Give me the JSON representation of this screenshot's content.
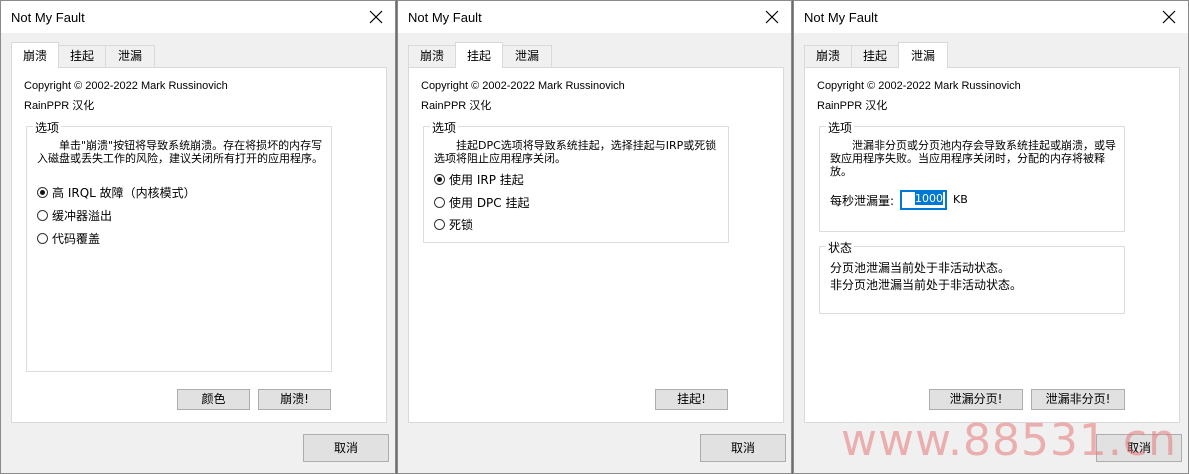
{
  "windows": [
    {
      "title": "Not My Fault",
      "tabs": [
        "崩溃",
        "挂起",
        "泄漏"
      ],
      "copyright": "Copyright © 2002-2022 Mark Russinovich",
      "credit": "RainPPR 汉化",
      "group_label": "选项",
      "description": "单击\"崩溃\"按钮将导致系统崩溃。存在将损坏的内存写入磁盘或丢失工作的风险，建议关闭所有打开的应用程序。",
      "options": [
        "高 IRQL 故障（内核模式）",
        "缓冲器溢出",
        "代码覆盖"
      ],
      "buttons": [
        "颜色",
        "崩溃!"
      ],
      "cancel": "取消"
    },
    {
      "title": "Not My Fault",
      "tabs": [
        "崩溃",
        "挂起",
        "泄漏"
      ],
      "copyright": "Copyright © 2002-2022 Mark Russinovich",
      "credit": "RainPPR 汉化",
      "group_label": "选项",
      "description": "挂起DPC选项将导致系统挂起，选择挂起与IRP或死锁选项将阻止应用程序关闭。",
      "options": [
        "使用 IRP 挂起",
        "使用 DPC 挂起",
        "死锁"
      ],
      "buttons": [
        "挂起!"
      ],
      "cancel": "取消"
    },
    {
      "title": "Not My Fault",
      "tabs": [
        "崩溃",
        "挂起",
        "泄漏"
      ],
      "copyright": "Copyright © 2002-2022 Mark Russinovich",
      "credit": "RainPPR 汉化",
      "group_label": "选项",
      "description": "泄漏非分页或分页池内存会导致系统挂起或崩溃，或导致应用程序失败。当应用程序关闭时，分配的内存将被释放。",
      "rate_label": "每秒泄漏量:",
      "rate_value": "1000",
      "rate_unit": "KB",
      "status_label": "状态",
      "status_lines": [
        "分页池泄漏当前处于非活动状态。",
        "非分页池泄漏当前处于非活动状态。"
      ],
      "buttons": [
        "泄漏分页!",
        "泄漏非分页!"
      ],
      "cancel": "取消"
    }
  ],
  "watermark": "www.88531.cn",
  "colors": {
    "accent": "#0078d7",
    "window_bg": "#f0f0f0"
  }
}
